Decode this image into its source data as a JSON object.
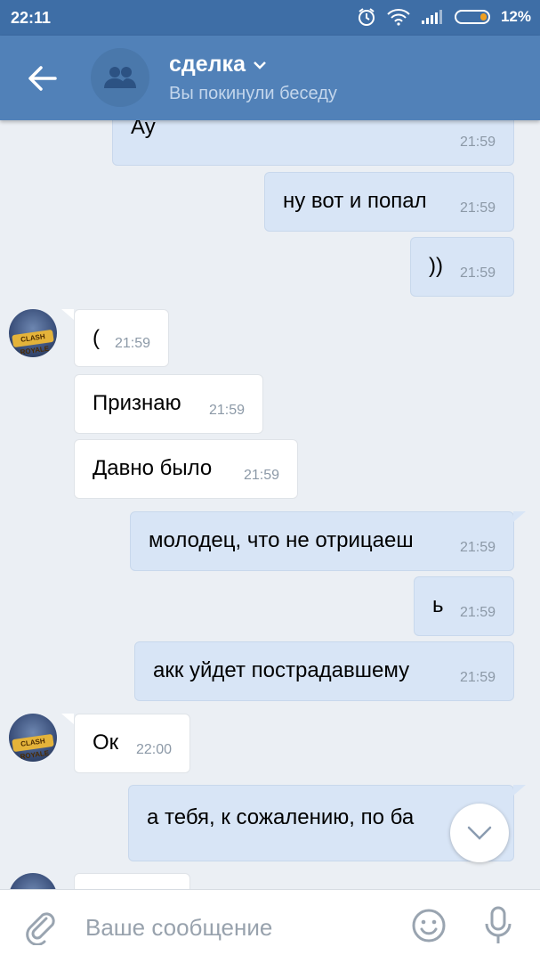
{
  "status_bar": {
    "time": "22:11",
    "battery": "12%"
  },
  "header": {
    "title": "сделка",
    "subtitle": "Вы покинули беседу"
  },
  "messages": [
    {
      "dir": "out",
      "text": "Ау",
      "time": "21:59"
    },
    {
      "dir": "out",
      "text": "ну вот и попал",
      "time": "21:59"
    },
    {
      "dir": "out",
      "text": "))",
      "time": "21:59"
    },
    {
      "dir": "in",
      "text": "(",
      "time": "21:59"
    },
    {
      "dir": "in",
      "text": "Признаю",
      "time": "21:59"
    },
    {
      "dir": "in",
      "text": "Давно было",
      "time": "21:59"
    },
    {
      "dir": "out",
      "text": "молодец, что не отрицаеш",
      "time": "21:59"
    },
    {
      "dir": "out",
      "text": "ь",
      "time": "21:59"
    },
    {
      "dir": "out",
      "text": "акк уйдет пострадавшему",
      "time": "21:59"
    },
    {
      "dir": "in",
      "text": "Ок",
      "time": "22:00"
    },
    {
      "dir": "out",
      "text": "а тебя, к сожалению, по ба",
      "time": ""
    }
  ],
  "avatar_badge": "CLASH ROYALE",
  "composer": {
    "placeholder": "Ваше сообщение"
  },
  "icons": {
    "back": "arrow-left-icon",
    "group_avatar": "people-icon",
    "dropdown": "chevron-down-icon",
    "scroll_down": "chevron-down-icon",
    "attach": "paperclip-icon",
    "emoji": "smile-icon",
    "mic": "microphone-icon",
    "alarm": "alarm-icon",
    "wifi": "wifi-icon",
    "signal": "signal-icon",
    "battery": "battery-icon"
  },
  "colors": {
    "header": "#5181b8",
    "status_bar": "#3e6ea6",
    "outgoing": "#d8e5f6",
    "incoming": "#ffffff",
    "background": "#ebeff4"
  }
}
